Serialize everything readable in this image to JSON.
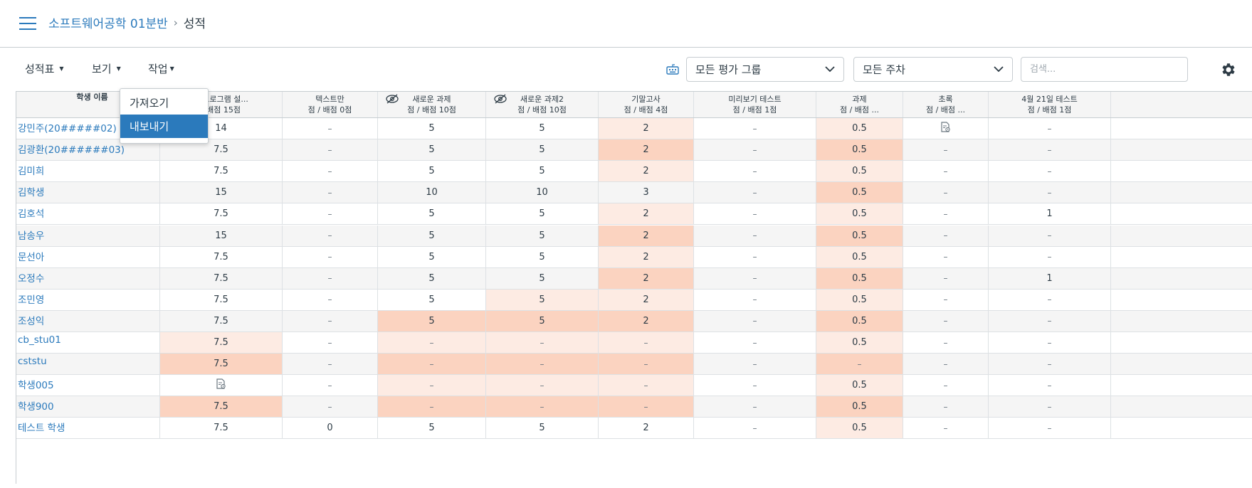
{
  "breadcrumb": {
    "course": "소프트웨어공학 01분반",
    "separator": "›",
    "current": "성적"
  },
  "toolbar": {
    "gradebook_menu": "성적표",
    "view_menu": "보기",
    "actions_menu": "작업",
    "group_filter": "모든 평가 그룹",
    "week_filter": "모든 주차",
    "search_placeholder": "검색..."
  },
  "actions_dropdown": {
    "items": [
      "가져오기",
      "내보내기"
    ],
    "highlighted_index": 1
  },
  "grid": {
    "student_header": "학생 이름",
    "columns": [
      {
        "title": "[] 프로그램 설...",
        "sub": "/ 배점 15점",
        "hidden": false
      },
      {
        "title": "텍스트만",
        "sub": "점 / 배점 0점",
        "hidden": false
      },
      {
        "title": "새로운 과제",
        "sub": "점 / 배점 10점",
        "hidden": true
      },
      {
        "title": "새로운 과제2",
        "sub": "점 / 배점 10점",
        "hidden": true
      },
      {
        "title": "기말고사",
        "sub": "점 / 배점 4점",
        "hidden": false
      },
      {
        "title": "미리보기 테스트",
        "sub": "점 / 배점 1점",
        "hidden": false
      },
      {
        "title": "과제",
        "sub": "점 / 배점 ...",
        "hidden": false
      },
      {
        "title": "초록",
        "sub": "점 / 배점 ...",
        "hidden": false
      },
      {
        "title": "4월 21일 테스트",
        "sub": "점 / 배점 1점",
        "hidden": false
      }
    ],
    "rows": [
      {
        "name": "강민주(20#####02)",
        "cells": [
          "14",
          "–",
          "5",
          "5",
          "2",
          "–",
          "0.5",
          "doc-icon",
          "–"
        ],
        "shade": [
          "",
          "",
          "",
          "",
          "light",
          "",
          "light",
          "",
          ""
        ]
      },
      {
        "name": "김광환(20######03)",
        "cells": [
          "7.5",
          "–",
          "5",
          "5",
          "2",
          "–",
          "0.5",
          "–",
          "–"
        ],
        "shade": [
          "",
          "",
          "",
          "",
          "dark",
          "",
          "dark",
          "",
          ""
        ]
      },
      {
        "name": "김미희",
        "cells": [
          "7.5",
          "–",
          "5",
          "5",
          "2",
          "–",
          "0.5",
          "–",
          "–"
        ],
        "shade": [
          "",
          "",
          "",
          "",
          "light",
          "",
          "light",
          "",
          ""
        ]
      },
      {
        "name": "김학생",
        "cells": [
          "15",
          "–",
          "10",
          "10",
          "3",
          "–",
          "0.5",
          "–",
          "–"
        ],
        "shade": [
          "",
          "",
          "",
          "",
          "",
          "",
          "dark",
          "",
          ""
        ]
      },
      {
        "name": "김호석",
        "cells": [
          "7.5",
          "–",
          "5",
          "5",
          "2",
          "–",
          "0.5",
          "–",
          "1"
        ],
        "shade": [
          "",
          "",
          "",
          "",
          "light",
          "",
          "light",
          "",
          ""
        ]
      },
      {
        "name": "남송우",
        "cells": [
          "15",
          "–",
          "5",
          "5",
          "2",
          "–",
          "0.5",
          "–",
          "–"
        ],
        "shade": [
          "",
          "",
          "",
          "",
          "dark",
          "",
          "dark",
          "",
          ""
        ]
      },
      {
        "name": "문선아",
        "cells": [
          "7.5",
          "–",
          "5",
          "5",
          "2",
          "–",
          "0.5",
          "–",
          "–"
        ],
        "shade": [
          "",
          "",
          "",
          "",
          "light",
          "",
          "light",
          "",
          ""
        ]
      },
      {
        "name": "오정수",
        "cells": [
          "7.5",
          "–",
          "5",
          "5",
          "2",
          "–",
          "0.5",
          "–",
          "1"
        ],
        "shade": [
          "",
          "",
          "",
          "",
          "dark",
          "",
          "dark",
          "",
          ""
        ]
      },
      {
        "name": "조민영",
        "cells": [
          "7.5",
          "–",
          "5",
          "5",
          "2",
          "–",
          "0.5",
          "–",
          "–"
        ],
        "shade": [
          "",
          "",
          "",
          "light",
          "light",
          "",
          "light",
          "",
          ""
        ]
      },
      {
        "name": "조성익",
        "cells": [
          "7.5",
          "–",
          "5",
          "5",
          "2",
          "–",
          "0.5",
          "–",
          "–"
        ],
        "shade": [
          "",
          "",
          "dark",
          "dark",
          "dark",
          "",
          "dark",
          "",
          ""
        ]
      },
      {
        "name": "cb_stu01",
        "cells": [
          "7.5",
          "–",
          "–",
          "–",
          "–",
          "–",
          "0.5",
          "–",
          "–"
        ],
        "shade": [
          "light",
          "",
          "light",
          "light",
          "light",
          "",
          "light",
          "",
          ""
        ]
      },
      {
        "name": "cststu",
        "cells": [
          "7.5",
          "–",
          "–",
          "–",
          "–",
          "–",
          "–",
          "–",
          "–"
        ],
        "shade": [
          "dark",
          "",
          "dark",
          "dark",
          "dark",
          "",
          "dark",
          "",
          ""
        ]
      },
      {
        "name": "학생005",
        "cells": [
          "doc-icon",
          "–",
          "–",
          "–",
          "–",
          "–",
          "0.5",
          "–",
          "–"
        ],
        "shade": [
          "",
          "",
          "light",
          "light",
          "light",
          "",
          "light",
          "",
          ""
        ]
      },
      {
        "name": "학생900",
        "cells": [
          "7.5",
          "–",
          "–",
          "–",
          "–",
          "–",
          "0.5",
          "–",
          "–"
        ],
        "shade": [
          "dark",
          "",
          "dark",
          "dark",
          "dark",
          "",
          "dark",
          "",
          ""
        ]
      },
      {
        "name": "테스트 학생",
        "cells": [
          "7.5",
          "0",
          "5",
          "5",
          "2",
          "–",
          "0.5",
          "–",
          "–"
        ],
        "shade": [
          "",
          "",
          "",
          "",
          "",
          "",
          "light",
          "",
          ""
        ]
      }
    ]
  },
  "colors": {
    "link": "#2b7abc",
    "highlight": "#2b7abc",
    "shade_light": "#fdebe3",
    "shade_dark": "#fbd3c0"
  }
}
